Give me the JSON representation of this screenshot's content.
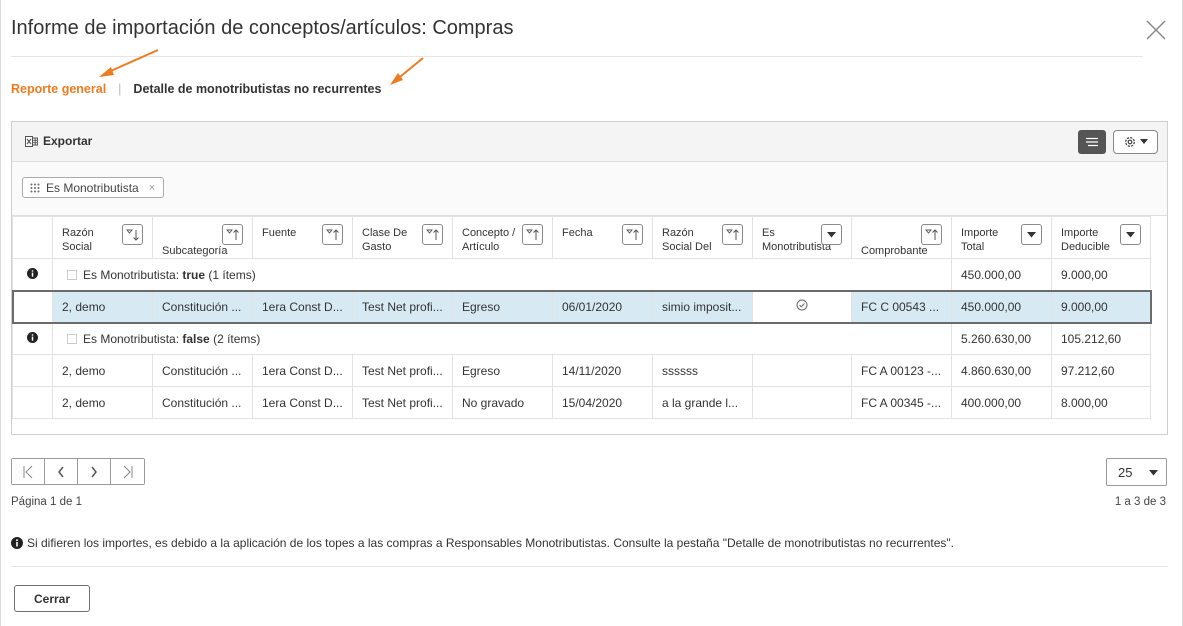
{
  "dialog": {
    "title": "Informe de importación de conceptos/artículos: Compras"
  },
  "tabs": [
    {
      "label": "Reporte general",
      "active": true
    },
    {
      "label": "Detalle de monotributistas no recurrentes",
      "active": false
    }
  ],
  "tab_separator": "|",
  "toolbar": {
    "export_label": "Exportar"
  },
  "grouping": {
    "chip_label": "Es Monotributista",
    "chip_remove": "×"
  },
  "columns": [
    {
      "label": "Razón Social",
      "sort": "desc"
    },
    {
      "label": "Subcategoría",
      "sort": "asc"
    },
    {
      "label": "Fuente",
      "sort": "asc"
    },
    {
      "label": "Clase De Gasto",
      "sort": "asc"
    },
    {
      "label": "Concepto / Artículo",
      "sort": "asc"
    },
    {
      "label": "Fecha",
      "sort": "asc"
    },
    {
      "label": "Razón Social Del",
      "sort": "asc"
    },
    {
      "label": "Es Monotributista",
      "sort": "menu"
    },
    {
      "label": "Comprobante",
      "sort": "asc"
    },
    {
      "label": "Importe Total",
      "sort": "menu"
    },
    {
      "label": "Importe Deducible",
      "sort": "menu"
    }
  ],
  "groups": [
    {
      "prefix": "Es Monotributista: ",
      "value": "true",
      "count": " (1 ítems)",
      "total": "450.000,00",
      "deducible": "9.000,00",
      "rows": [
        {
          "cells": [
            "2, demo",
            "Constitución ...",
            "1era Const D...",
            "Test Net profi...",
            "Egreso",
            "06/01/2020",
            "simio imposit...",
            "",
            "FC C 00543 ...",
            "450.000,00",
            "9.000,00"
          ],
          "selected": true,
          "check": true
        }
      ]
    },
    {
      "prefix": "Es Monotributista: ",
      "value": "false",
      "count": " (2 ítems)",
      "total": "5.260.630,00",
      "deducible": "105.212,60",
      "rows": [
        {
          "cells": [
            "2, demo",
            "Constitución ...",
            "1era Const D...",
            "Test Net profi...",
            "Egreso",
            "14/11/2020",
            "ssssss",
            "",
            "FC A 00123 -...",
            "4.860.630,00",
            "97.212,60"
          ],
          "selected": false,
          "check": false
        },
        {
          "cells": [
            "2, demo",
            "Constitución ...",
            "1era Const D...",
            "Test Net profi...",
            "No gravado",
            "15/04/2020",
            "a la grande l...",
            "",
            "FC A 00345 -...",
            "400.000,00",
            "8.000,00"
          ],
          "selected": false,
          "check": false
        }
      ]
    }
  ],
  "pager": {
    "page_size": "25",
    "page_info": "Página 1 de 1",
    "count_info": "1 a 3 de 3"
  },
  "note": "Si difieren los importes, es debido a la aplicación de los topes a las compras a Responsables Monotributistas. Consulte la pestaña \"Detalle de monotributistas no recurrentes\".",
  "footer": {
    "close_label": "Cerrar"
  },
  "colors": {
    "accent": "#ef7b1f",
    "selected_row": "#d7eaf3"
  }
}
